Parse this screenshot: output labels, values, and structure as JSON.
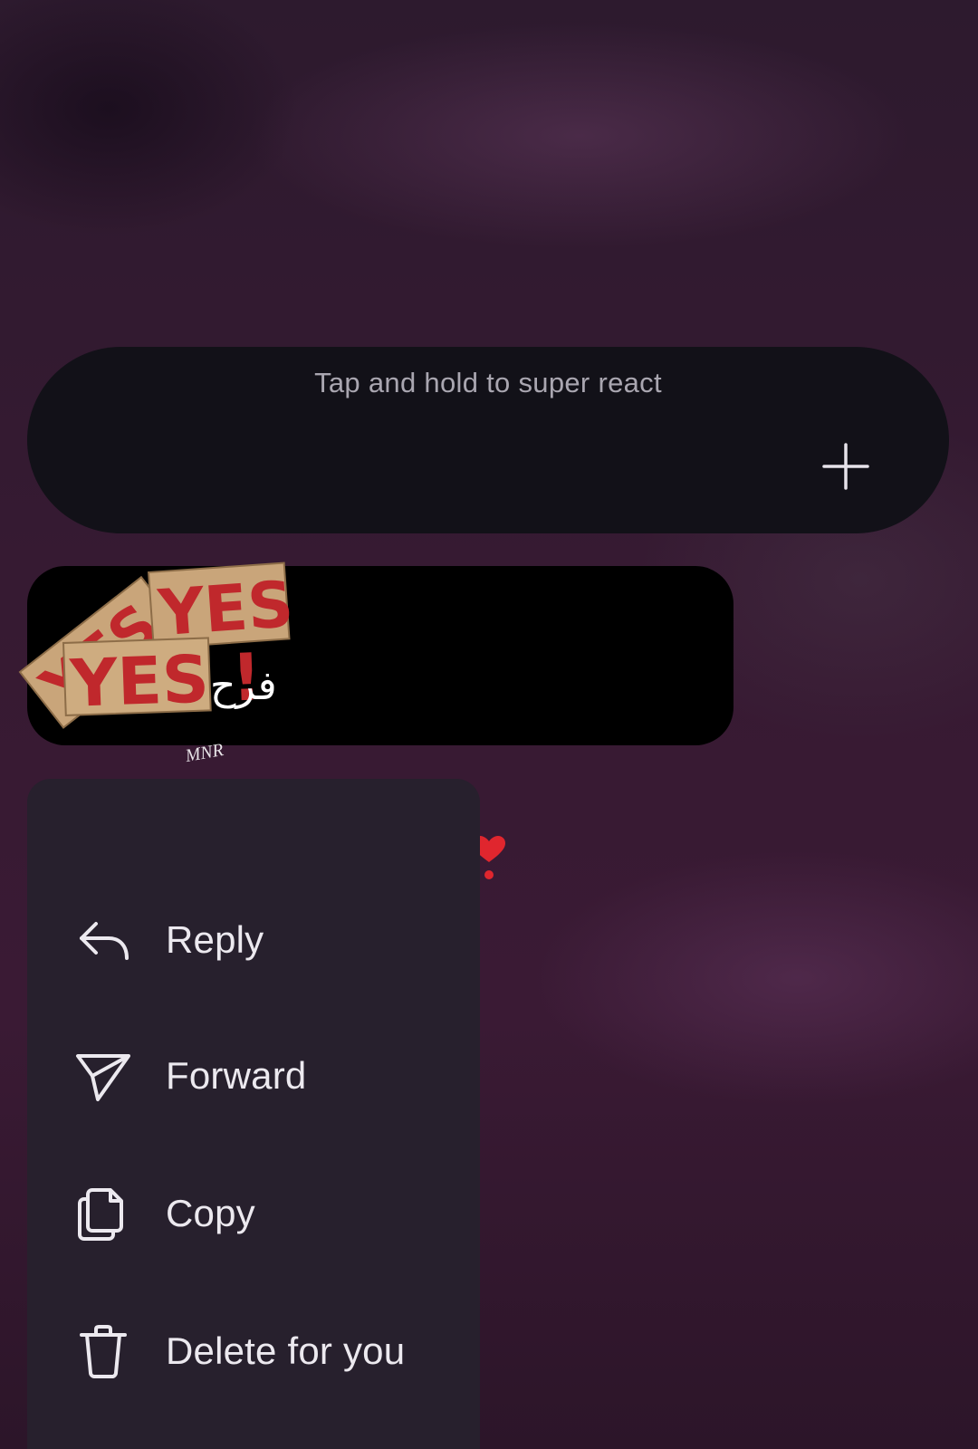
{
  "reaction_bar": {
    "hint": "Tap and hold to super react",
    "add_icon": "plus-icon"
  },
  "message": {
    "text": "فرح",
    "sticker_text": "YES !",
    "sticker_signature": "MNR",
    "reaction": "❣️"
  },
  "menu": {
    "items": [
      {
        "label": "Reply",
        "icon": "reply-arrow-icon"
      },
      {
        "label": "Forward",
        "icon": "paper-plane-icon"
      },
      {
        "label": "Copy",
        "icon": "copy-icon"
      },
      {
        "label": "Delete for you",
        "icon": "trash-icon"
      }
    ]
  },
  "colors": {
    "background": "#3a1a34",
    "bar": "#121118",
    "bubble": "#000000",
    "menu": "#27202d",
    "sticker_red": "#c0282c",
    "sticker_paper": "#c9a57a"
  }
}
